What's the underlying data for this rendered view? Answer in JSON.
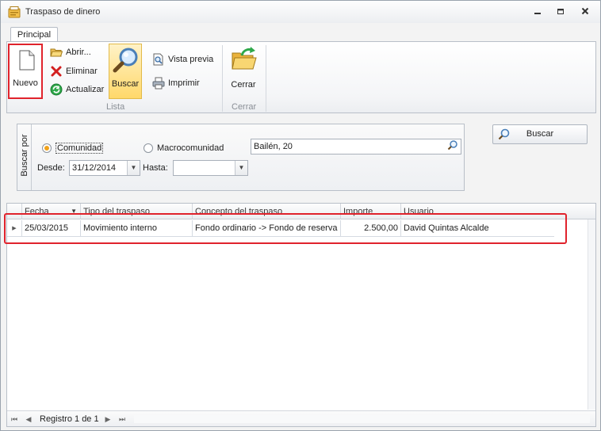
{
  "window": {
    "title": "Traspaso de dinero"
  },
  "ribbon": {
    "tab": "Principal",
    "groups": {
      "lista": {
        "label": "Lista",
        "nuevo": "Nuevo",
        "abrir": "Abrir...",
        "eliminar": "Eliminar",
        "actualizar": "Actualizar",
        "buscar": "Buscar",
        "vista_previa": "Vista previa",
        "imprimir": "Imprimir"
      },
      "cerrar": {
        "label": "Cerrar",
        "cerrar": "Cerrar"
      }
    }
  },
  "search": {
    "panel_title": "Buscar por",
    "radio_comunidad": "Comunidad",
    "radio_macro": "Macrocomunidad",
    "selected": "Comunidad",
    "search_text": "Bailén, 20",
    "desde_label": "Desde:",
    "desde_value": "31/12/2014",
    "hasta_label": "Hasta:",
    "hasta_value": "",
    "buscar_button": "Buscar"
  },
  "grid": {
    "columns": [
      "Fecha",
      "Tipo del traspaso",
      "Concepto del traspaso",
      "Importe",
      "Usuario"
    ],
    "rows": [
      {
        "fecha": "25/03/2015",
        "tipo": "Movimiento interno",
        "concepto": "Fondo ordinario -> Fondo de reserva",
        "importe": "2.500,00",
        "usuario": "David Quintas Alcalde"
      }
    ],
    "navigator": "Registro 1 de 1"
  },
  "colors": {
    "accent": "#f0a21b",
    "highlight": "#e0232c",
    "selected_button": "#ffd86a"
  },
  "icons": [
    "app-icon",
    "minimize-icon",
    "restore-icon",
    "close-icon",
    "new-document-icon",
    "open-folder-icon",
    "delete-icon",
    "refresh-icon",
    "magnifier-icon",
    "print-preview-icon",
    "printer-icon",
    "exit-folder-icon"
  ]
}
